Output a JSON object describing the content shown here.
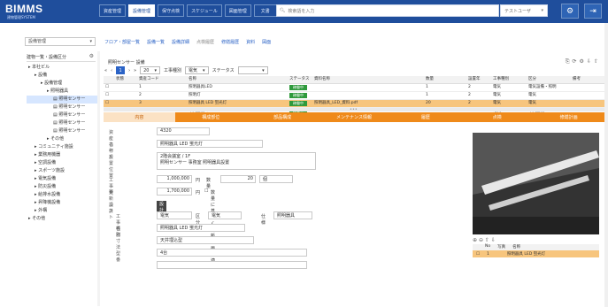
{
  "app": {
    "logo": "BIMMS",
    "logo_sub": "建物管理SYSTEM",
    "top_tabs": [
      "資産管理",
      "設備管理",
      "保守点検",
      "スケジュール",
      "図面管理",
      "文書"
    ],
    "active_tab": 1,
    "search_placeholder": "検索語を入力",
    "user": "テストユーザ",
    "colors": {
      "header": "#1f4e9c",
      "accent": "#ef8a1a",
      "selected_row": "#f7c57d",
      "status_green": "#2f9a3c"
    }
  },
  "left": {
    "select_value": "設備管理",
    "tree_header": "建物一覧・設備区分",
    "tree": [
      {
        "label": "本社ビル",
        "level": 0
      },
      {
        "label": "設備",
        "level": 1
      },
      {
        "label": "設備管理",
        "level": 2
      },
      {
        "label": "照明器具",
        "level": 3
      },
      {
        "label": "照明センサー",
        "level": 4,
        "selected": true
      },
      {
        "label": "照明センサー",
        "level": 4
      },
      {
        "label": "照明センサー",
        "level": 4
      },
      {
        "label": "照明センサー",
        "level": 4
      },
      {
        "label": "照明センサー",
        "level": 4
      },
      {
        "label": "その他",
        "level": 3
      },
      {
        "label": "コミュニティ施設",
        "level": 1
      },
      {
        "label": "業務用機器",
        "level": 1
      },
      {
        "label": "空調設備",
        "level": 1
      },
      {
        "label": "スポーツ施設",
        "level": 1
      },
      {
        "label": "電気設備",
        "level": 1
      },
      {
        "label": "防災設備",
        "level": 1
      },
      {
        "label": "給排水設備",
        "level": 1
      },
      {
        "label": "昇降機設備",
        "level": 1
      },
      {
        "label": "外構",
        "level": 1
      },
      {
        "label": "その他",
        "level": 0
      }
    ]
  },
  "breadcrumb": [
    "フロア・部屋一覧",
    "設備一覧",
    "設備詳細",
    "点検履歴",
    "修繕履歴",
    "資料",
    "図面"
  ],
  "grid": {
    "title": "照明センサー 設備",
    "pager": {
      "current": "1",
      "per_page": "20",
      "filter1_label": "工事種別",
      "filter1_value": "電気",
      "filter2_label": "ステータス",
      "filter2_value": ""
    },
    "columns": [
      "状態",
      "資産コード",
      "名称",
      "ステータス",
      "資料名称",
      "数量",
      "設置年",
      "工事種別",
      "区分",
      "備考"
    ],
    "rows": [
      {
        "code": "1",
        "name": "照明器具LED",
        "status": "稼働中",
        "doc": "",
        "qty": "1",
        "year": "2",
        "type": "電気",
        "cat": "電気設備・照明",
        "hl": false
      },
      {
        "code": "2",
        "name": "照明灯",
        "status": "稼働中",
        "doc": "",
        "qty": "1",
        "year": "2",
        "type": "電気",
        "cat": "電気",
        "hl": false
      },
      {
        "code": "3",
        "name": "照明器具 LED 蛍光灯",
        "status": "稼働中",
        "doc": "照明器具_LED_資料.pdf",
        "qty": "20",
        "year": "2",
        "type": "電気",
        "cat": "電気",
        "hl": true
      },
      {
        "code": "4",
        "name": "中央監視コンソール",
        "status": "稼働中",
        "doc": "",
        "qty": "1",
        "year": "2",
        "type": "電気",
        "cat": "中央監視",
        "hl": false
      }
    ]
  },
  "detail_tabs": [
    "内容",
    "構成部位",
    "部品構成",
    "メンテナンス情報",
    "履歴",
    "点検",
    "修繕計画"
  ],
  "form": {
    "asset_code_label": "資産コード",
    "asset_code": "4320",
    "name_label": "名称",
    "name": "照明器具 LED 蛍光灯",
    "location_label": "設置位置",
    "location": "2階会議室 / 1F\n照明センサー 事務室 照明器具設置",
    "cost_label": "工事費",
    "cost": "1,000,000",
    "cost_unit": "円",
    "qty_label": "数量",
    "qty": "20",
    "qty_unit": "個",
    "renew_label": "更新コスト",
    "renew": "1,700,000",
    "renew_unit": "円",
    "checkbox_label": "数量に基づく更新計画を適用",
    "section_label": "設計",
    "section_badge": "設計",
    "kind_label": "工事種別",
    "kind": "電気",
    "div_label": "区分",
    "div": "電気",
    "spec_label": "仕様",
    "spec": "照明器具",
    "name2_label": "名称",
    "name2": "照明器具 LED 蛍光灯",
    "size_label": "寸法",
    "size": "天井埋込型",
    "model_label": "型番",
    "model": "4台",
    "extra_label": "",
    "extra": ""
  },
  "photos": {
    "list_columns": [
      "No",
      "写真",
      "名称"
    ],
    "list_rows": [
      {
        "no": "1",
        "name": "照明器具 LED 蛍光灯"
      }
    ]
  }
}
